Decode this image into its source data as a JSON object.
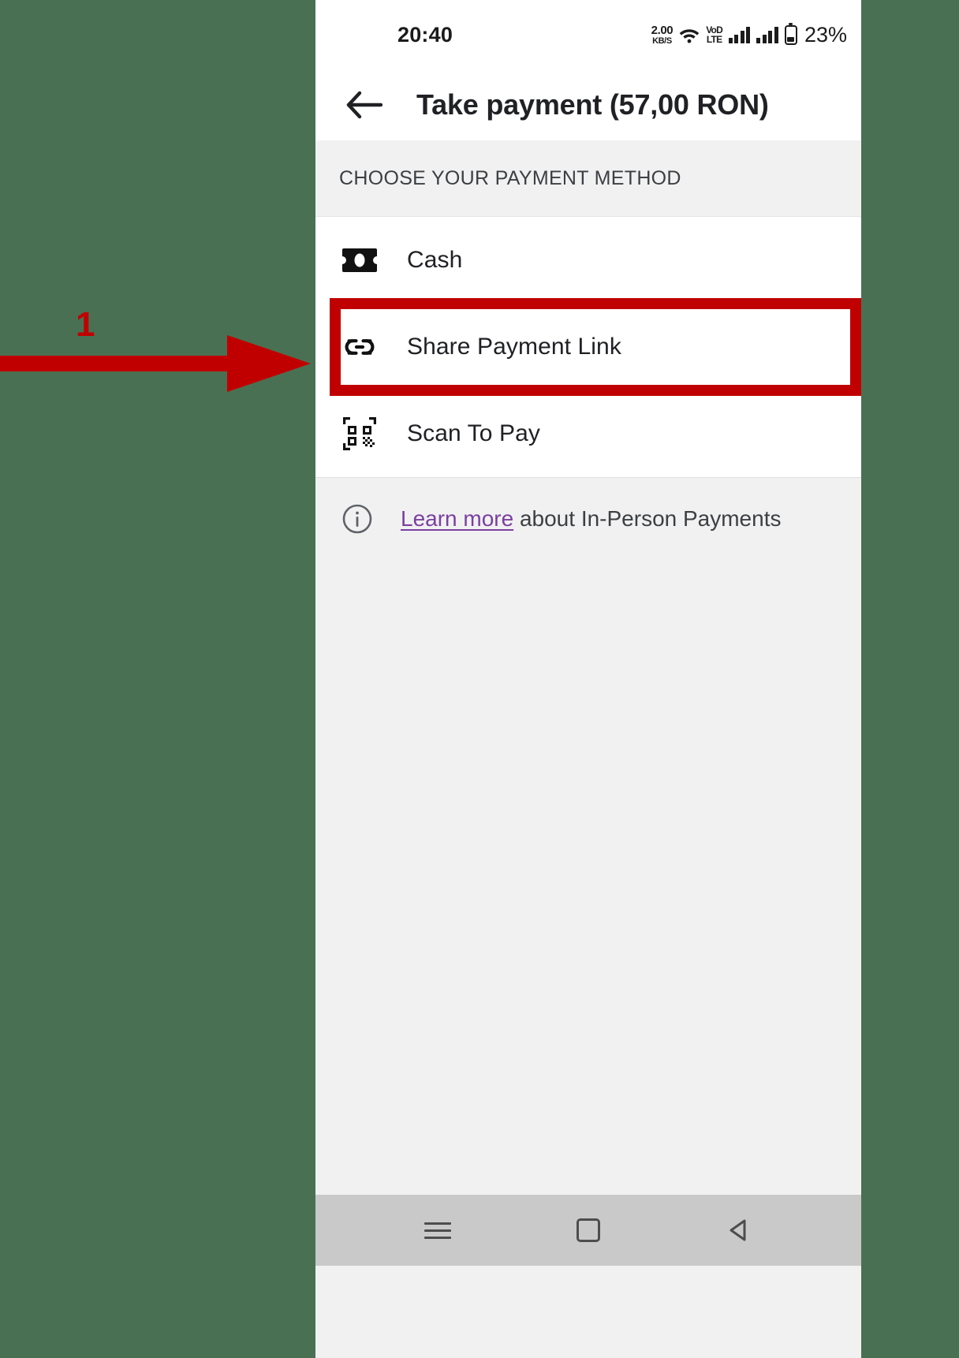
{
  "theme": {
    "backdrop_color": "#4a7053",
    "accent_annotation_color": "#c00000",
    "link_color": "#7b3fa0",
    "surface_color": "#ffffff",
    "page_background": "#f1f1f1"
  },
  "status_bar": {
    "time": "20:40",
    "network_speed_value": "2.00",
    "network_speed_unit": "KB/S",
    "wifi_icon": "wifi-icon",
    "volte_line1": "VoD",
    "volte_line2": "LTE",
    "signal_1_icon": "signal-bars-icon",
    "signal_2_icon": "signal-bars-icon",
    "battery_icon": "battery-icon",
    "battery_percent": "23%"
  },
  "app_bar": {
    "back_icon": "back-arrow-icon",
    "title": "Take payment (57,00 RON)"
  },
  "section": {
    "header": "CHOOSE YOUR PAYMENT METHOD"
  },
  "payment_methods": [
    {
      "label": "Cash",
      "icon": "cash-banknote-icon"
    },
    {
      "label": "Share Payment Link",
      "icon": "link-icon"
    },
    {
      "label": "Scan To Pay",
      "icon": "qr-code-icon"
    }
  ],
  "info_row": {
    "icon": "info-circle-icon",
    "link_text": "Learn more",
    "rest_text": " about In-Person Payments"
  },
  "nav_bar": {
    "menu_icon": "menu-icon",
    "home_icon": "home-square-icon",
    "back_icon": "back-triangle-icon"
  },
  "annotation": {
    "step_number": "1",
    "arrow_icon": "pointer-arrow-icon",
    "highlight_target": "Share Payment Link"
  }
}
